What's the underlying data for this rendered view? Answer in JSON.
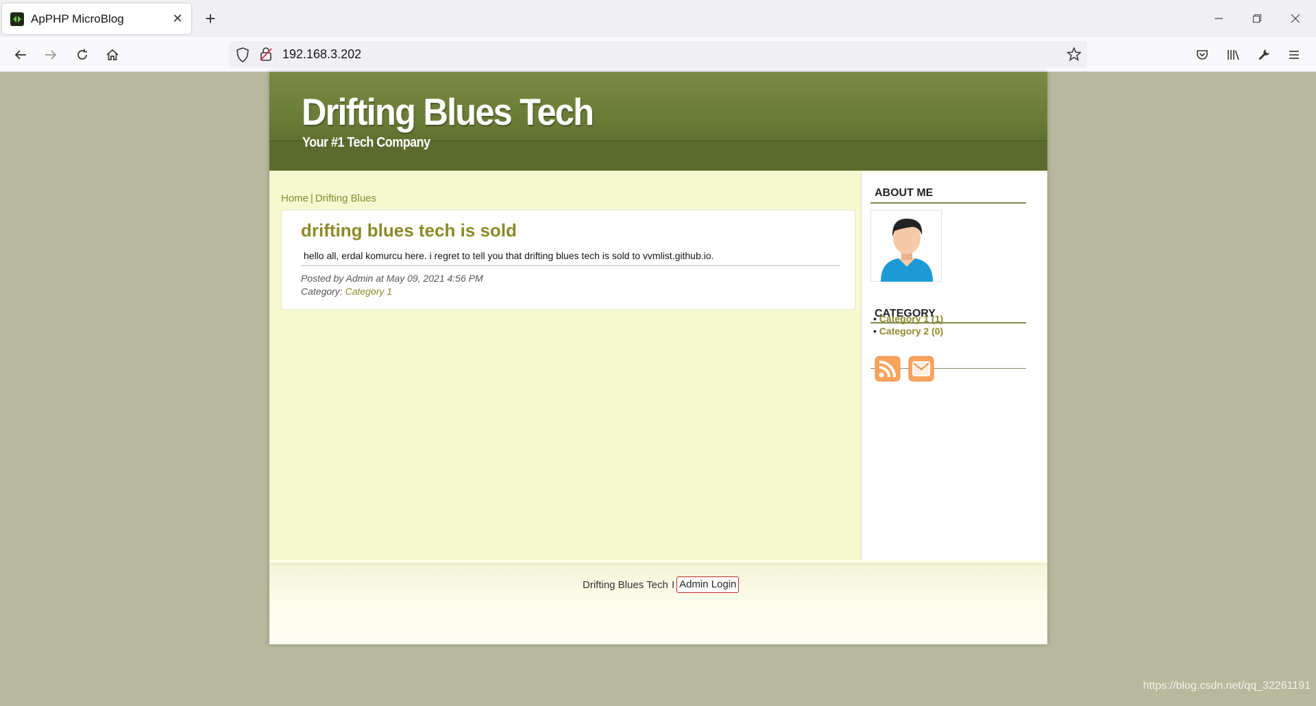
{
  "browser": {
    "tab_title": "ApPHP MicroBlog",
    "url": "192.168.3.202"
  },
  "site": {
    "title": "Drifting Blues Tech",
    "subtitle": "Your #1 Tech Company"
  },
  "breadcrumb": {
    "home": "Home",
    "separator": "|",
    "current": "Drifting Blues"
  },
  "post": {
    "title": "drifting blues tech is sold",
    "body": "hello all, erdal komurcu here. i regret to tell you that drifting blues tech is sold to vvmlist.github.io.",
    "posted_by": "Posted by Admin at May 09, 2021 4:56 PM",
    "category_label": "Category:",
    "category_link": "Category 1"
  },
  "sidebar": {
    "about_heading": "ABOUT ME",
    "category_heading": "CATEGORY",
    "categories": [
      {
        "bullet": "•",
        "label": "Category 1 (1)"
      },
      {
        "bullet": "•",
        "label": "Category 2 (0)"
      }
    ]
  },
  "footer": {
    "text": "Drifting Blues Tech",
    "separator": "I",
    "admin_login": "Admin Login"
  },
  "watermark": "https://blog.csdn.net/qq_32261191",
  "colors": {
    "header_green": "#677935",
    "link_olive": "#8b8a27",
    "content_bg": "#f6f8d0",
    "page_bg": "#b7b99d"
  }
}
